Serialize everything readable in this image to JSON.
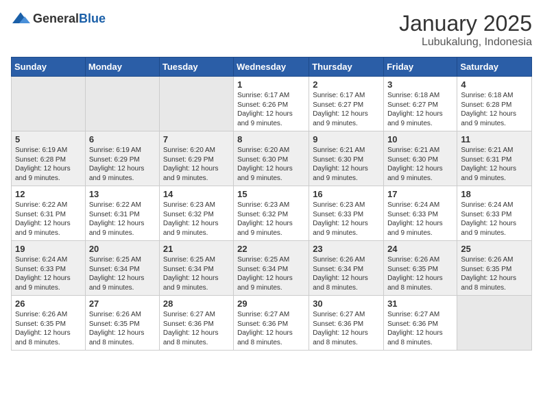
{
  "logo": {
    "general": "General",
    "blue": "Blue"
  },
  "header": {
    "month": "January 2025",
    "location": "Lubukalung, Indonesia"
  },
  "weekdays": [
    "Sunday",
    "Monday",
    "Tuesday",
    "Wednesday",
    "Thursday",
    "Friday",
    "Saturday"
  ],
  "weeks": [
    [
      {
        "day": "",
        "info": ""
      },
      {
        "day": "",
        "info": ""
      },
      {
        "day": "",
        "info": ""
      },
      {
        "day": "1",
        "info": "Sunrise: 6:17 AM\nSunset: 6:26 PM\nDaylight: 12 hours and 9 minutes."
      },
      {
        "day": "2",
        "info": "Sunrise: 6:17 AM\nSunset: 6:27 PM\nDaylight: 12 hours and 9 minutes."
      },
      {
        "day": "3",
        "info": "Sunrise: 6:18 AM\nSunset: 6:27 PM\nDaylight: 12 hours and 9 minutes."
      },
      {
        "day": "4",
        "info": "Sunrise: 6:18 AM\nSunset: 6:28 PM\nDaylight: 12 hours and 9 minutes."
      }
    ],
    [
      {
        "day": "5",
        "info": "Sunrise: 6:19 AM\nSunset: 6:28 PM\nDaylight: 12 hours and 9 minutes."
      },
      {
        "day": "6",
        "info": "Sunrise: 6:19 AM\nSunset: 6:29 PM\nDaylight: 12 hours and 9 minutes."
      },
      {
        "day": "7",
        "info": "Sunrise: 6:20 AM\nSunset: 6:29 PM\nDaylight: 12 hours and 9 minutes."
      },
      {
        "day": "8",
        "info": "Sunrise: 6:20 AM\nSunset: 6:30 PM\nDaylight: 12 hours and 9 minutes."
      },
      {
        "day": "9",
        "info": "Sunrise: 6:21 AM\nSunset: 6:30 PM\nDaylight: 12 hours and 9 minutes."
      },
      {
        "day": "10",
        "info": "Sunrise: 6:21 AM\nSunset: 6:30 PM\nDaylight: 12 hours and 9 minutes."
      },
      {
        "day": "11",
        "info": "Sunrise: 6:21 AM\nSunset: 6:31 PM\nDaylight: 12 hours and 9 minutes."
      }
    ],
    [
      {
        "day": "12",
        "info": "Sunrise: 6:22 AM\nSunset: 6:31 PM\nDaylight: 12 hours and 9 minutes."
      },
      {
        "day": "13",
        "info": "Sunrise: 6:22 AM\nSunset: 6:31 PM\nDaylight: 12 hours and 9 minutes."
      },
      {
        "day": "14",
        "info": "Sunrise: 6:23 AM\nSunset: 6:32 PM\nDaylight: 12 hours and 9 minutes."
      },
      {
        "day": "15",
        "info": "Sunrise: 6:23 AM\nSunset: 6:32 PM\nDaylight: 12 hours and 9 minutes."
      },
      {
        "day": "16",
        "info": "Sunrise: 6:23 AM\nSunset: 6:33 PM\nDaylight: 12 hours and 9 minutes."
      },
      {
        "day": "17",
        "info": "Sunrise: 6:24 AM\nSunset: 6:33 PM\nDaylight: 12 hours and 9 minutes."
      },
      {
        "day": "18",
        "info": "Sunrise: 6:24 AM\nSunset: 6:33 PM\nDaylight: 12 hours and 9 minutes."
      }
    ],
    [
      {
        "day": "19",
        "info": "Sunrise: 6:24 AM\nSunset: 6:33 PM\nDaylight: 12 hours and 9 minutes."
      },
      {
        "day": "20",
        "info": "Sunrise: 6:25 AM\nSunset: 6:34 PM\nDaylight: 12 hours and 9 minutes."
      },
      {
        "day": "21",
        "info": "Sunrise: 6:25 AM\nSunset: 6:34 PM\nDaylight: 12 hours and 9 minutes."
      },
      {
        "day": "22",
        "info": "Sunrise: 6:25 AM\nSunset: 6:34 PM\nDaylight: 12 hours and 9 minutes."
      },
      {
        "day": "23",
        "info": "Sunrise: 6:26 AM\nSunset: 6:34 PM\nDaylight: 12 hours and 8 minutes."
      },
      {
        "day": "24",
        "info": "Sunrise: 6:26 AM\nSunset: 6:35 PM\nDaylight: 12 hours and 8 minutes."
      },
      {
        "day": "25",
        "info": "Sunrise: 6:26 AM\nSunset: 6:35 PM\nDaylight: 12 hours and 8 minutes."
      }
    ],
    [
      {
        "day": "26",
        "info": "Sunrise: 6:26 AM\nSunset: 6:35 PM\nDaylight: 12 hours and 8 minutes."
      },
      {
        "day": "27",
        "info": "Sunrise: 6:26 AM\nSunset: 6:35 PM\nDaylight: 12 hours and 8 minutes."
      },
      {
        "day": "28",
        "info": "Sunrise: 6:27 AM\nSunset: 6:36 PM\nDaylight: 12 hours and 8 minutes."
      },
      {
        "day": "29",
        "info": "Sunrise: 6:27 AM\nSunset: 6:36 PM\nDaylight: 12 hours and 8 minutes."
      },
      {
        "day": "30",
        "info": "Sunrise: 6:27 AM\nSunset: 6:36 PM\nDaylight: 12 hours and 8 minutes."
      },
      {
        "day": "31",
        "info": "Sunrise: 6:27 AM\nSunset: 6:36 PM\nDaylight: 12 hours and 8 minutes."
      },
      {
        "day": "",
        "info": ""
      }
    ]
  ]
}
